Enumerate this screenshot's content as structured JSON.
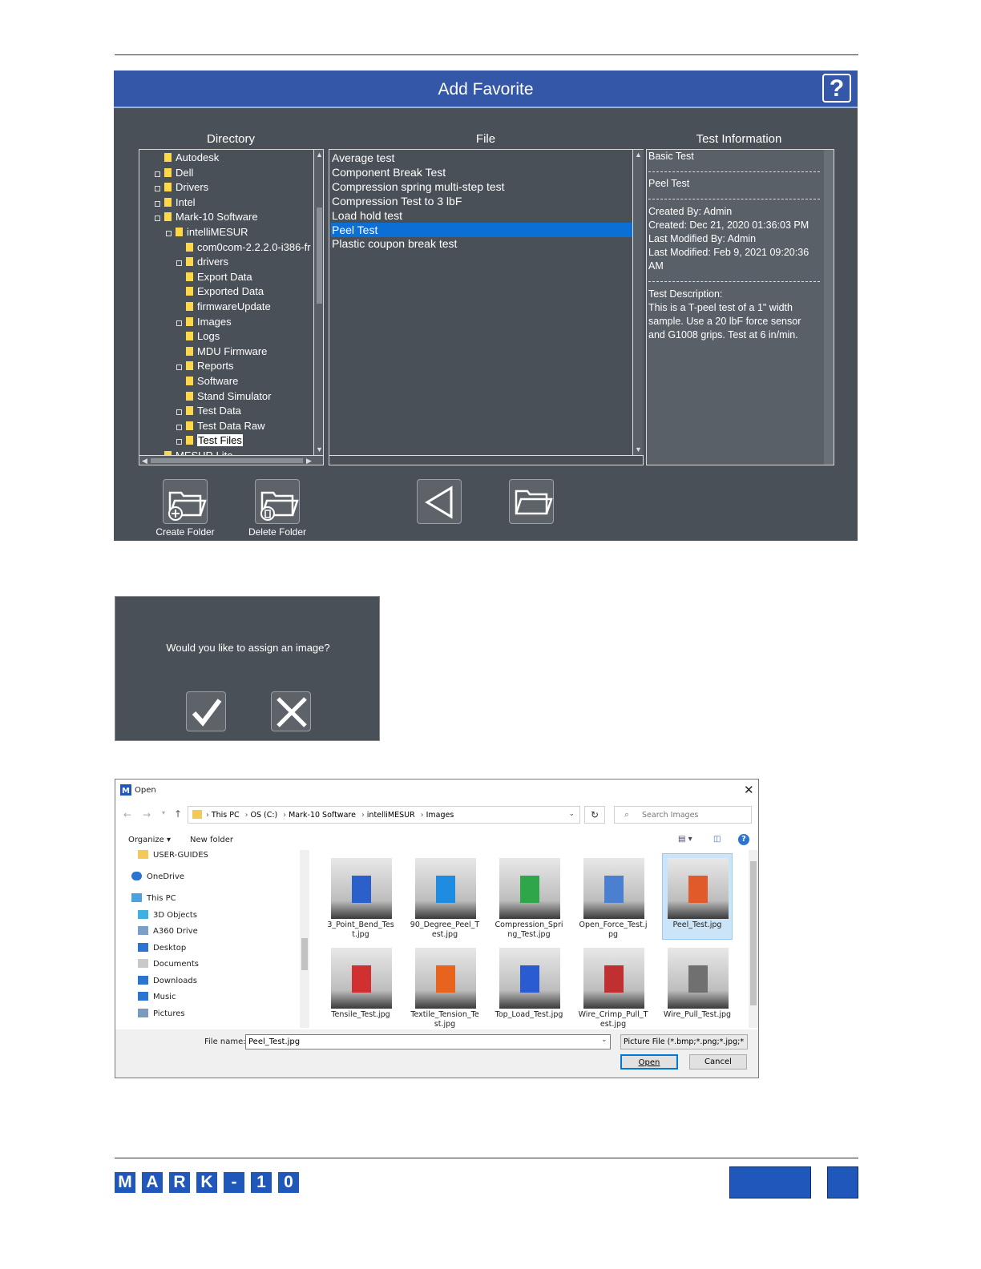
{
  "add_favorite": {
    "title": "Add Favorite",
    "help_label": "?",
    "headers": {
      "directory": "Directory",
      "file": "File",
      "info": "Test Information"
    },
    "directory": [
      "Autodesk",
      "Dell",
      "Drivers",
      "Intel",
      "Mark-10 Software",
      "intelliMESUR",
      "com0com-2.2.2.0-i386-fr",
      "drivers",
      "Export Data",
      "Exported Data",
      "firmwareUpdate",
      "Images",
      "Logs",
      "MDU Firmware",
      "Reports",
      "Software",
      "Stand Simulator",
      "Test Data",
      "Test Data Raw",
      "Test Files",
      "MESUR Lite"
    ],
    "files": [
      "Average test",
      "Component Break Test",
      "Compression spring multi-step test",
      "Compression Test to 3 lbF",
      "Load hold test",
      "Peel Test",
      "Plastic coupon break test"
    ],
    "selected_file": "Peel Test",
    "info": {
      "test_type": "Basic Test",
      "test_name": "Peel Test",
      "created_by": "Created By: Admin",
      "created": "Created: Dec 21, 2020 01:36:03 PM",
      "modified_by": "Last Modified By: Admin",
      "modified_1": "Last Modified: Feb 9, 2021 09:20:36",
      "modified_2": "AM",
      "desc_label": "Test Description:",
      "desc_1": "This is a T-peel test of a 1\" width",
      "desc_2": "sample. Use a 20 lbF force sensor",
      "desc_3": "and G1008 grips. Test at 6 in/min."
    },
    "buttons": {
      "create_folder": "Create Folder",
      "delete_folder": "Delete Folder"
    }
  },
  "assign_dialog": {
    "question": "Would you like to assign an image?"
  },
  "open_dialog": {
    "title": "Open",
    "breadcrumb": [
      "This PC",
      "OS (C:)",
      "Mark-10 Software",
      "intelliMESUR",
      "Images"
    ],
    "search_placeholder": "Search Images",
    "organize": "Organize ▾",
    "new_folder": "New folder",
    "nav": [
      "USER-GUIDES",
      "OneDrive",
      "This PC",
      "3D Objects",
      "A360 Drive",
      "Desktop",
      "Documents",
      "Downloads",
      "Music",
      "Pictures"
    ],
    "files": [
      "3_Point_Bend_Test.jpg",
      "90_Degree_Peel_Test.jpg",
      "Compression_Spring_Test.jpg",
      "Open_Force_Test.jpg",
      "Peel_Test.jpg",
      "Tensile_Test.jpg",
      "Textile_Tension_Test.jpg",
      "Top_Load_Test.jpg",
      "Wire_Crimp_Pull_Test.jpg",
      "Wire_Pull_Test.jpg"
    ],
    "selected": "Peel_Test.jpg",
    "file_name_label": "File name:",
    "file_name": "Peel_Test.jpg",
    "file_type": "Picture File (*.bmp;*.png;*.jpg;*",
    "open_btn": "Open",
    "cancel_btn": "Cancel"
  },
  "footer": {
    "logo": [
      "M",
      "A",
      "R",
      "K",
      "-",
      "1",
      "0"
    ]
  },
  "colors": {
    "panel": "#4a5057",
    "title_bar": "#3557a8",
    "selection": "#0c6fd6",
    "brand": "#1f58ba"
  }
}
